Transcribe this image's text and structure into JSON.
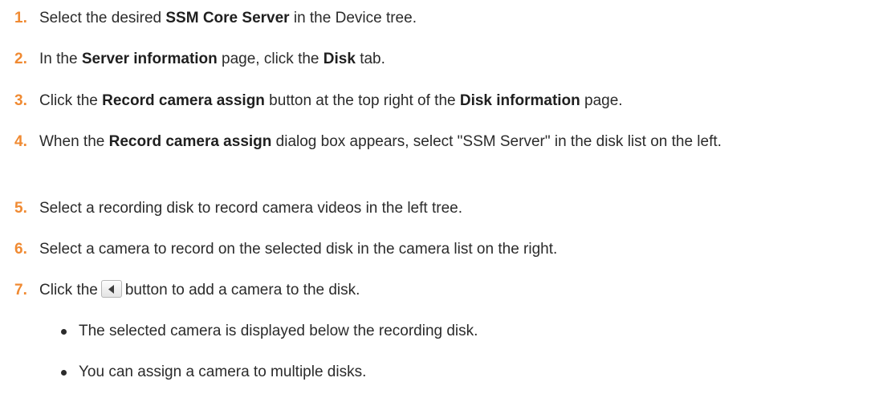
{
  "steps": [
    {
      "num": "1.",
      "p1": "Select the desired ",
      "b1": "SSM Core Server",
      "p2": " in the Device tree."
    },
    {
      "num": "2.",
      "p1": "In the ",
      "b1": "Server information",
      "p2": " page, click the ",
      "b2": "Disk",
      "p3": " tab."
    },
    {
      "num": "3.",
      "p1": "Click the ",
      "b1": "Record camera assign",
      "p2": " button at the top right of the ",
      "b2": "Disk information",
      "p3": " page."
    },
    {
      "num": "4.",
      "p1": "When the ",
      "b1": "Record camera assign",
      "p2": " dialog box appears, select \"SSM Server\" in the disk list on the left."
    },
    {
      "num": "5.",
      "p1": "Select a recording disk to record camera videos in the left tree."
    },
    {
      "num": "6.",
      "p1": "Select a camera to record on the selected disk in the camera list on the right."
    },
    {
      "num": "7.",
      "p1": "Click the",
      "icon": "left-arrow-icon",
      "p2": "button to add a camera to the disk."
    }
  ],
  "bullets": [
    "The selected camera is displayed below the recording disk.",
    "You can assign a camera to multiple disks."
  ],
  "colors": {
    "step_number": "#f08a32",
    "text": "#2b2b2b"
  }
}
